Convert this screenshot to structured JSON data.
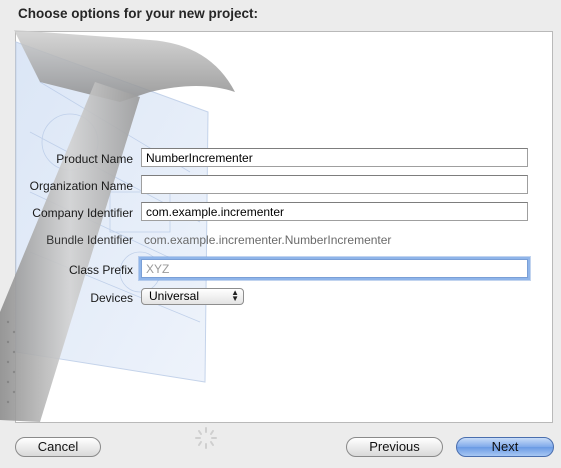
{
  "dialog": {
    "title": "Choose options for your new project:"
  },
  "form": {
    "product_name": {
      "label": "Product Name",
      "value": "NumberIncrementer"
    },
    "organization_name": {
      "label": "Organization Name",
      "value": ""
    },
    "company_identifier": {
      "label": "Company Identifier",
      "value": "com.example.incrementer"
    },
    "bundle_identifier": {
      "label": "Bundle Identifier",
      "value": "com.example.incrementer.NumberIncrementer"
    },
    "class_prefix": {
      "label": "Class Prefix",
      "value": "",
      "placeholder": "XYZ"
    },
    "devices": {
      "label": "Devices",
      "selected": "Universal"
    }
  },
  "buttons": {
    "cancel": "Cancel",
    "previous": "Previous",
    "next": "Next"
  },
  "colors": {
    "primary_button": "#7fa9ea",
    "focus_ring": "#8fb5ea"
  }
}
